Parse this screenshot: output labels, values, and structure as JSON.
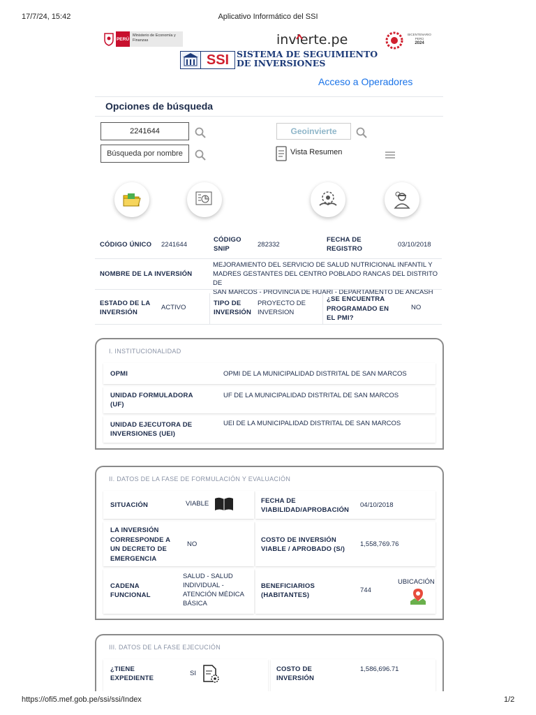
{
  "print_header": {
    "datetime": "17/7/24, 15:42",
    "title": "Aplicativo Informático del SSI"
  },
  "print_footer": {
    "url": "https://ofi5.mef.gob.pe/ssi/ssi/Index",
    "page": "1/2"
  },
  "logos": {
    "peru": "PERÚ",
    "ministry": "Ministerio de Economía y Finanzas",
    "invierte": "invierte.pe",
    "ssi": "SSI",
    "ssi_title_1": "SISTEMA DE SEGUIMIENTO",
    "ssi_title_2": "DE INVERSIONES",
    "bicentenario_1": "BICENTENARIO",
    "bicentenario_2": "PERÚ",
    "bicentenario_3": "2024"
  },
  "nav": {
    "operators_link": "Acceso a Operadores"
  },
  "search": {
    "heading": "Opciones de búsqueda",
    "code_value": "2241644",
    "name_placeholder": "Búsqueda por nombre",
    "geo_logo": "Geoinvierte",
    "summary_label": "Vista Resumen"
  },
  "summary": {
    "codigo_unico_label": "CÓDIGO ÚNICO",
    "codigo_unico": "2241644",
    "snip_label_1": "CÓDIGO",
    "snip_label_2": "SNIP",
    "snip": "282332",
    "fecha_label_1": "FECHA DE",
    "fecha_label_2": "REGISTRO",
    "fecha": "03/10/2018",
    "nombre_label": "NOMBRE DE LA INVERSIÓN",
    "nombre_1": "MEJORAMIENTO DEL SERVICIO DE SALUD NUTRICIONAL INFANTIL Y",
    "nombre_2": "MADRES GESTANTES DEL CENTRO POBLADO RANCAS DEL DISTRITO DE",
    "nombre_3": "SAN MARCOS - PROVINCIA DE HUARI - DEPARTAMENTO DE ANCASH",
    "estado_label_1": "ESTADO DE LA",
    "estado_label_2": "INVERSIÓN",
    "estado": "ACTIVO",
    "tipo_label_1": "TIPO DE",
    "tipo_label_2": "INVERSIÓN",
    "tipo_1": "PROYECTO DE",
    "tipo_2": "INVERSION",
    "pmi_label_1": "¿SE ENCUENTRA",
    "pmi_label_2": "PROGRAMADO EN",
    "pmi_label_3": "EL PMI?",
    "pmi": "NO"
  },
  "section1": {
    "title": "I. INSTITUCIONALIDAD",
    "opmi_label": "OPMI",
    "opmi": "OPMI DE LA MUNICIPALIDAD DISTRITAL DE SAN MARCOS",
    "uf_label_1": "UNIDAD FORMULADORA",
    "uf_label_2": "(UF)",
    "uf": "UF DE LA MUNICIPALIDAD DISTRITAL DE SAN MARCOS",
    "uei_label_1": "UNIDAD EJECUTORA DE",
    "uei_label_2": "INVERSIONES (UEI)",
    "uei": "UEI DE LA MUNICIPALIDAD DISTRITAL DE SAN MARCOS"
  },
  "section2": {
    "title": "II. DATOS DE LA FASE DE FORMULACIÓN Y EVALUACIÓN",
    "situacion_label": "SITUACIÓN",
    "situacion": "VIABLE",
    "fecha_label_1": "FECHA DE",
    "fecha_label_2": "VIABILIDAD/APROBACIÓN",
    "fecha": "04/10/2018",
    "decreto_label_1": "LA INVERSIÓN",
    "decreto_label_2": "CORRESPONDE A",
    "decreto_label_3": "UN DECRETO DE",
    "decreto_label_4": "EMERGENCIA",
    "decreto": "NO",
    "costo_label_1": "COSTO DE INVERSIÓN",
    "costo_label_2": "VIABLE / APROBADO (S/)",
    "costo": "1,558,769.76",
    "cadena_label_1": "CADENA",
    "cadena_label_2": "FUNCIONAL",
    "cadena_1": "SALUD - SALUD",
    "cadena_2": "INDIVIDUAL -",
    "cadena_3": "ATENCIÓN MÉDICA",
    "cadena_4": "BÁSICA",
    "benef_label_1": "BENEFICIARIOS",
    "benef_label_2": "(HABITANTES)",
    "benef": "744",
    "ubicacion": "UBICACIÓN"
  },
  "section3": {
    "title": "III. DATOS DE LA FASE EJECUCIÓN",
    "exp_label_1": "¿TIENE",
    "exp_label_2": "EXPEDIENTE",
    "exp": "SI",
    "costo_label_1": "COSTO DE",
    "costo_label_2": "INVERSIÓN",
    "costo": "1,586,696.71"
  },
  "colors": {
    "accent_blue": "#1a73e8",
    "ssi_red": "#d0202e",
    "peru_red": "#c8102e",
    "navy": "#1c2b4a"
  }
}
